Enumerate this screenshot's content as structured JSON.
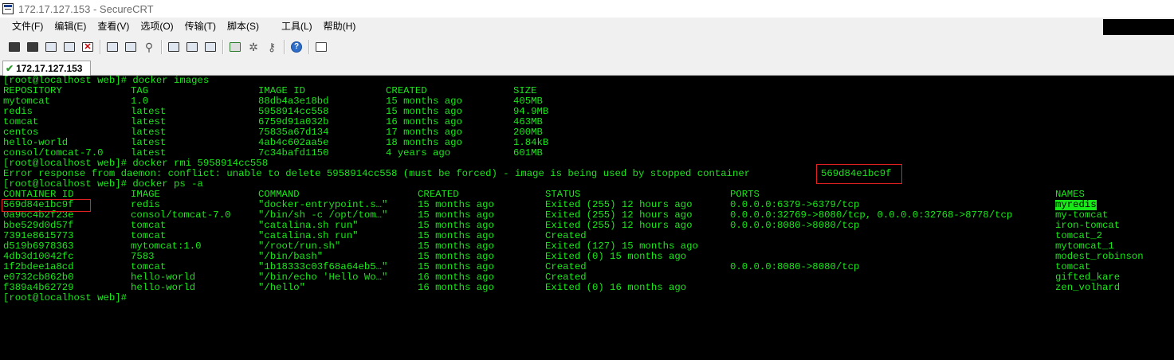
{
  "window": {
    "title": "172.17.127.153 - SecureCRT"
  },
  "menu": [
    "文件(F)",
    "编辑(E)",
    "查看(V)",
    "选项(O)",
    "传输(T)",
    "脚本(S)",
    "工具(L)",
    "帮助(H)"
  ],
  "toolbar": {
    "icons": [
      "connect-icon",
      "quick-connect-icon",
      "connect-tab-icon",
      "reconnect-icon",
      "disconnect-icon",
      "copy-icon",
      "paste-icon",
      "find-icon",
      "print-icon",
      "print-setup-icon",
      "print-selection-icon",
      "session-options-icon",
      "global-options-icon",
      "key-icon",
      "help-icon",
      "screen-icon"
    ]
  },
  "tab": {
    "label": "172.17.127.153"
  },
  "terminal": {
    "prompt1": "[root@localhost web]# docker images",
    "images_header": [
      "REPOSITORY",
      "TAG",
      "IMAGE ID",
      "CREATED",
      "SIZE"
    ],
    "images": [
      [
        "mytomcat",
        "1.0",
        "88db4a3e18bd",
        "15 months ago",
        "405MB"
      ],
      [
        "redis",
        "latest",
        "5958914cc558",
        "15 months ago",
        "94.9MB"
      ],
      [
        "tomcat",
        "latest",
        "6759d91a032b",
        "16 months ago",
        "463MB"
      ],
      [
        "centos",
        "latest",
        "75835a67d134",
        "17 months ago",
        "200MB"
      ],
      [
        "hello-world",
        "latest",
        "4ab4c602aa5e",
        "18 months ago",
        "1.84kB"
      ],
      [
        "consol/tomcat-7.0",
        "latest",
        "7c34bafd1150",
        "4 years ago",
        "601MB"
      ]
    ],
    "prompt2": "[root@localhost web]# docker rmi 5958914cc558",
    "error_text": "Error response from daemon: conflict: unable to delete 5958914cc558 (must be forced) - image is being used by stopped container ",
    "error_container": "569d84e1bc9f",
    "prompt3": "[root@localhost web]# docker ps -a",
    "ps_header": [
      "CONTAINER ID",
      "IMAGE",
      "COMMAND",
      "CREATED",
      "STATUS",
      "PORTS",
      "NAMES"
    ],
    "containers": [
      [
        "569d84e1bc9f",
        "redis",
        "\"docker-entrypoint.s…\"",
        "15 months ago",
        "Exited (255) 12 hours ago",
        "0.0.0.0:6379->6379/tcp",
        "myredis"
      ],
      [
        "0a96c4b2f23e",
        "consol/tomcat-7.0",
        "\"/bin/sh -c /opt/tom…\"",
        "15 months ago",
        "Exited (255) 12 hours ago",
        "0.0.0.0:32769->8080/tcp, 0.0.0.0:32768->8778/tcp",
        "my-tomcat"
      ],
      [
        "bbe529d0d57f",
        "tomcat",
        "\"catalina.sh run\"",
        "15 months ago",
        "Exited (255) 12 hours ago",
        "0.0.0.0:8080->8080/tcp",
        "iron-tomcat"
      ],
      [
        "7391e8615773",
        "tomcat",
        "\"catalina.sh run\"",
        "15 months ago",
        "Created",
        "",
        "tomcat_2"
      ],
      [
        "d519b6978363",
        "mytomcat:1.0",
        "\"/root/run.sh\"",
        "15 months ago",
        "Exited (127) 15 months ago",
        "",
        "mytomcat_1"
      ],
      [
        "4db3d10042fc",
        "7583",
        "\"/bin/bash\"",
        "15 months ago",
        "Exited (0) 15 months ago",
        "",
        "modest_robinson"
      ],
      [
        "1f2bdee1a8cd",
        "tomcat",
        "\"1b18333c03f68a64eb5…\"",
        "15 months ago",
        "Created",
        "0.0.0.0:8080->8080/tcp",
        "tomcat"
      ],
      [
        "e0732cb862b0",
        "hello-world",
        "\"/bin/echo 'Hello Wo…\"",
        "16 months ago",
        "Created",
        "",
        "gifted_kare"
      ],
      [
        "f389a4b62729",
        "hello-world",
        "\"/hello\"",
        "16 months ago",
        "Exited (0) 16 months ago",
        "",
        "zen_volhard"
      ]
    ],
    "prompt4": "[root@localhost web]#"
  },
  "colors": {
    "terminal_bg": "#000000",
    "terminal_fg": "#18e818",
    "highlight_box": "#e02020"
  }
}
